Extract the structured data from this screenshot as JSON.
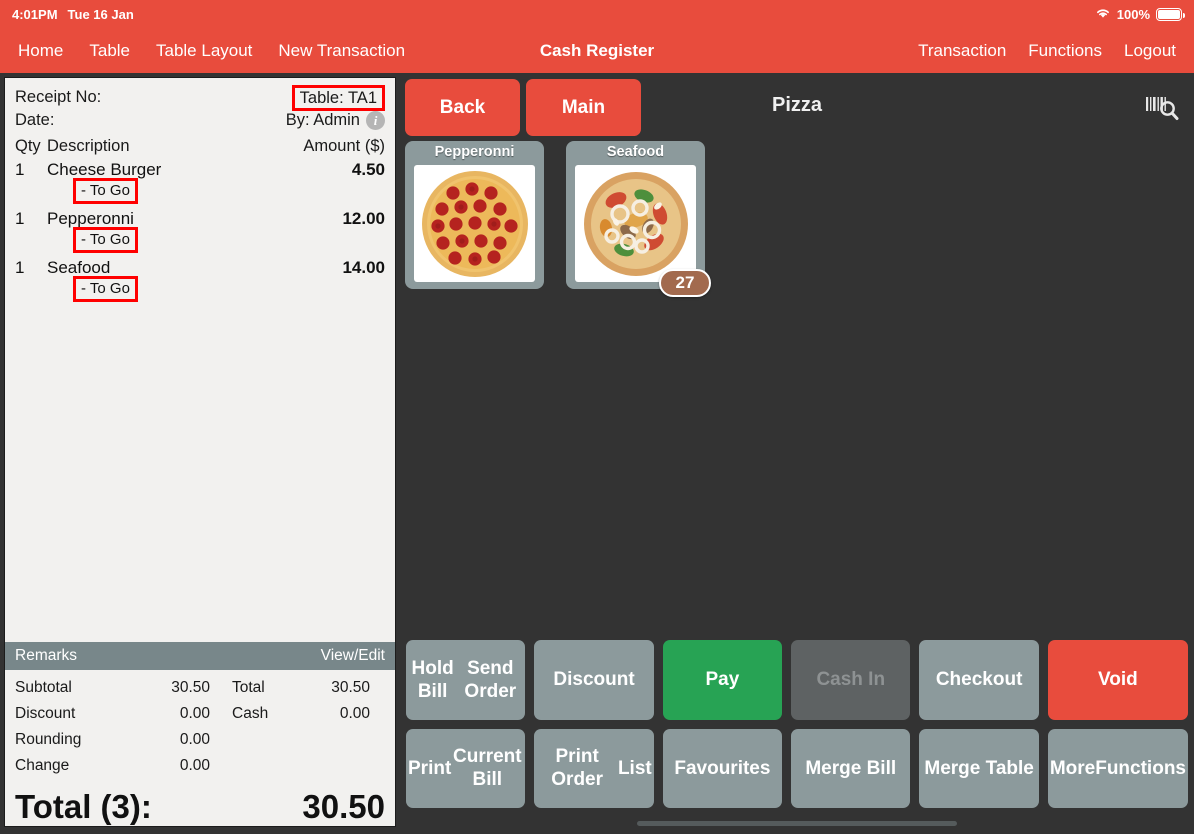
{
  "statusbar": {
    "time": "4:01PM",
    "date": "Tue 16 Jan",
    "battery_percent": "100%",
    "wifi_icon": "wifi-icon",
    "battery_icon": "battery-icon"
  },
  "navbar": {
    "title": "Cash Register",
    "left_items": [
      {
        "label": "Home"
      },
      {
        "label": "Table"
      },
      {
        "label": "Table Layout"
      },
      {
        "label": "New Transaction"
      }
    ],
    "right_items": [
      {
        "label": "Transaction"
      },
      {
        "label": "Functions"
      },
      {
        "label": "Logout"
      }
    ]
  },
  "receipt": {
    "receipt_no_label": "Receipt No:",
    "receipt_no_value": "",
    "date_label": "Date:",
    "date_value": "",
    "table_label": "Table: TA1",
    "cashier_label": "By: Admin",
    "info_icon": "info-icon",
    "columns": {
      "qty": "Qty",
      "description": "Description",
      "amount": "Amount ($)"
    },
    "items": [
      {
        "qty": "1",
        "name": "Cheese Burger",
        "modifier": "- To Go",
        "amount": "4.50"
      },
      {
        "qty": "1",
        "name": "Pepperonni",
        "modifier": "- To Go",
        "amount": "12.00"
      },
      {
        "qty": "1",
        "name": "Seafood",
        "modifier": "- To Go",
        "amount": "14.00"
      }
    ],
    "remarks_label": "Remarks",
    "remarks_action": "View/Edit",
    "summary": {
      "subtotal_label": "Subtotal",
      "subtotal_value": "30.50",
      "discount_label": "Discount",
      "discount_value": "0.00",
      "rounding_label": "Rounding",
      "rounding_value": "0.00",
      "change_label": "Change",
      "change_value": "0.00",
      "total_label": "Total",
      "total_value": "30.50",
      "cash_label": "Cash",
      "cash_value": "0.00"
    },
    "grand_total_label": "Total (3):",
    "grand_total_value": "30.50"
  },
  "catalog": {
    "back_label": "Back",
    "main_label": "Main",
    "category_title": "Pizza",
    "search_icon": "barcode-search-icon",
    "products": [
      {
        "name": "Pepperonni",
        "badge": "",
        "image": "pepperoni-pizza-image"
      },
      {
        "name": "Seafood",
        "badge": "27",
        "image": "seafood-pizza-image"
      }
    ]
  },
  "actions": [
    {
      "label": "Hold Bill\nSend Order",
      "style": "gray",
      "name": "hold-bill-send-order-button",
      "disabled": false
    },
    {
      "label": "Discount",
      "style": "gray",
      "name": "discount-button",
      "disabled": false
    },
    {
      "label": "Pay",
      "style": "green",
      "name": "pay-button",
      "disabled": false
    },
    {
      "label": "Cash In",
      "style": "disabled",
      "name": "cash-in-button",
      "disabled": true
    },
    {
      "label": "Checkout",
      "style": "gray",
      "name": "checkout-button",
      "disabled": false
    },
    {
      "label": "Void",
      "style": "red",
      "name": "void-button",
      "disabled": false
    },
    {
      "label": "Print\nCurrent Bill",
      "style": "gray",
      "name": "print-current-bill-button",
      "disabled": false
    },
    {
      "label": "Print Order\nList",
      "style": "gray",
      "name": "print-order-list-button",
      "disabled": false
    },
    {
      "label": "Favourites",
      "style": "gray",
      "name": "favourites-button",
      "disabled": false
    },
    {
      "label": "Merge Bill",
      "style": "gray",
      "name": "merge-bill-button",
      "disabled": false
    },
    {
      "label": "Merge Table",
      "style": "gray",
      "name": "merge-table-button",
      "disabled": false
    },
    {
      "label": "More\nFunctions",
      "style": "gray",
      "name": "more-functions-button",
      "disabled": false
    }
  ],
  "colors": {
    "brand_red": "#e84c3d",
    "pay_green": "#27a354",
    "button_gray": "#8c9a9c",
    "disabled_gray": "#5e6263",
    "app_background": "#333333",
    "receipt_paper": "#f2f1ef",
    "annotation_red": "#ff0000",
    "badge_brown": "#a26a4e"
  }
}
